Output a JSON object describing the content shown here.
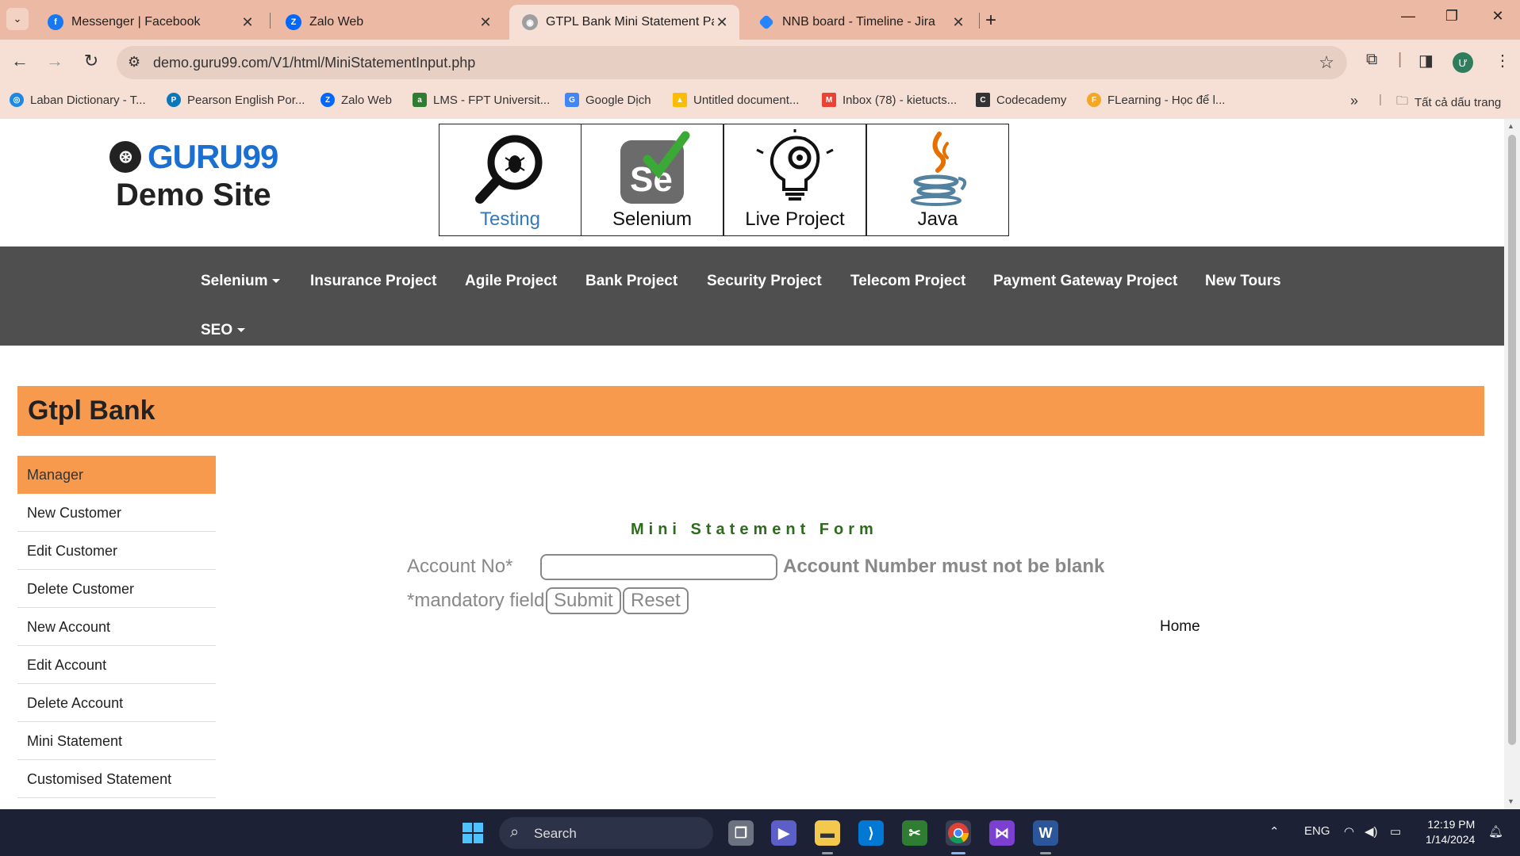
{
  "browser": {
    "tabs": [
      {
        "title": "Messenger | Facebook",
        "active": false
      },
      {
        "title": "Zalo Web",
        "active": false
      },
      {
        "title": "GTPL Bank Mini Statement Page",
        "active": true
      },
      {
        "title": "NNB board - Timeline - Jira",
        "active": false
      }
    ],
    "url": "demo.guru99.com/V1/html/MiniStatementInput.php",
    "bookmarks": [
      "Laban Dictionary - T...",
      "Pearson English Por...",
      "Zalo Web",
      "LMS - FPT Universit...",
      "Google Dịch",
      "Untitled document...",
      "Inbox (78) - kietucts...",
      "Codecademy",
      "FLearning - Học để l..."
    ],
    "all_bookmarks_label": "Tất cả dấu trang",
    "avatar_letter": "Ư"
  },
  "site": {
    "logo_text": "GURU99",
    "logo_subtitle": "Demo Site",
    "categories": [
      "Testing",
      "Selenium",
      "Live Project",
      "Java"
    ],
    "nav": [
      {
        "label": "Selenium",
        "dropdown": true
      },
      {
        "label": "Insurance Project",
        "dropdown": false
      },
      {
        "label": "Agile Project",
        "dropdown": false
      },
      {
        "label": "Bank Project",
        "dropdown": false
      },
      {
        "label": "Security Project",
        "dropdown": false
      },
      {
        "label": "Telecom Project",
        "dropdown": false
      },
      {
        "label": "Payment Gateway Project",
        "dropdown": false
      },
      {
        "label": "New Tours",
        "dropdown": false
      },
      {
        "label": "SEO",
        "dropdown": true
      }
    ]
  },
  "bank": {
    "title": "Gtpl Bank",
    "sidebar": [
      "Manager",
      "New Customer",
      "Edit Customer",
      "Delete Customer",
      "New Account",
      "Edit Account",
      "Delete Account",
      "Mini Statement",
      "Customised Statement"
    ],
    "form": {
      "title": "Mini Statement Form",
      "account_label": "Account No*",
      "account_value": "",
      "error": "Account Number must not be blank",
      "mandatory": "*mandatory field",
      "submit": "Submit",
      "reset": "Reset",
      "home": "Home"
    }
  },
  "taskbar": {
    "search_placeholder": "Search",
    "language": "ENG",
    "time": "12:19 PM",
    "date": "1/14/2024"
  },
  "colors": {
    "orange": "#f79a4e",
    "nav_bg": "#4f4f4f",
    "form_title": "#2e6b1e",
    "tab_bar": "#ecb9a5"
  }
}
